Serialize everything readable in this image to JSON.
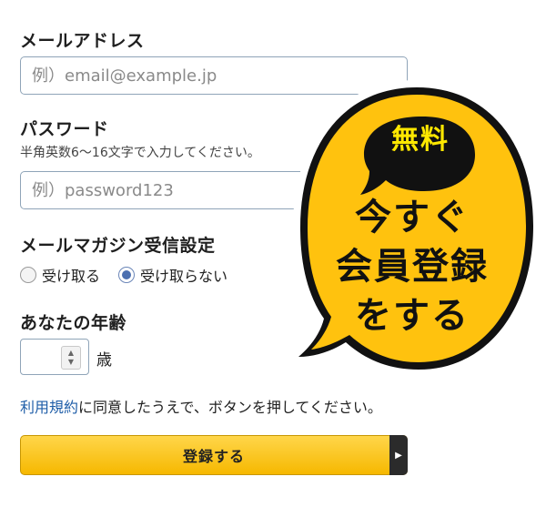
{
  "email": {
    "label": "メールアドレス",
    "placeholder": "例）email@example.jp"
  },
  "password": {
    "label": "パスワード",
    "hint": "半角英数6〜16文字で入力してください。",
    "placeholder": "例）password123"
  },
  "newsletter": {
    "label": "メールマガジン受信設定",
    "options": [
      {
        "label": "受け取る",
        "checked": false
      },
      {
        "label": "受け取らない",
        "checked": true
      }
    ]
  },
  "age": {
    "label": "あなたの年齢",
    "value": "",
    "unit": "歳"
  },
  "agreement": {
    "terms_link": "利用規約",
    "text": "に同意したうえで、ボタンを押してください。"
  },
  "submit": {
    "label": "登録する"
  },
  "promo": {
    "badge": "無料",
    "lines": [
      "今すぐ",
      "会員登録",
      "をする"
    ]
  },
  "colors": {
    "accent": "#f6b800",
    "promo_yellow": "#ffc20e",
    "link": "#1f5ea8",
    "input_border": "#8fa4b8"
  }
}
